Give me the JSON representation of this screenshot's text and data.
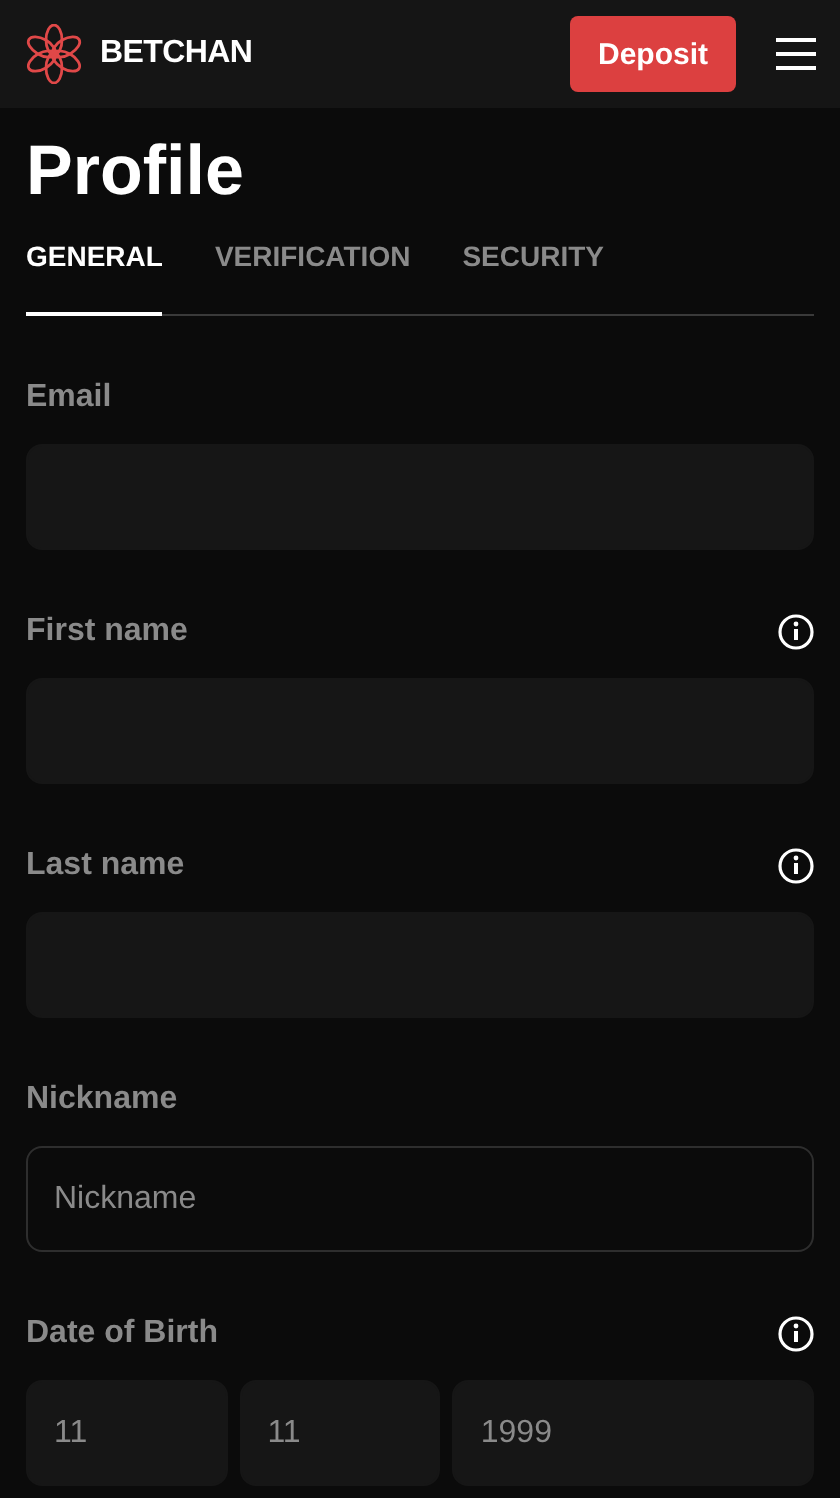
{
  "header": {
    "brand": "BETCHAN",
    "deposit_button": "Deposit"
  },
  "title": "Profile",
  "tabs": [
    {
      "label": "GENERAL",
      "selected": true
    },
    {
      "label": "VERIFICATION",
      "selected": false
    },
    {
      "label": "SECURITY",
      "selected": false
    }
  ],
  "fields": [
    {
      "label": "Email",
      "info": false,
      "inputs": [
        {
          "disabled": true
        }
      ]
    },
    {
      "label": "First name",
      "info": true,
      "inputs": [
        {
          "disabled": true
        }
      ]
    },
    {
      "label": "Last name",
      "info": true,
      "inputs": [
        {
          "disabled": true
        }
      ]
    },
    {
      "label": "Nickname",
      "info": false,
      "inputs": [
        {
          "disabled": false,
          "placeholder": "Nickname"
        }
      ]
    },
    {
      "label": "Date of Birth",
      "info": true,
      "inputs": [
        {
          "disabled": true,
          "value": "11"
        },
        {
          "disabled": true,
          "value": "11"
        },
        {
          "disabled": true,
          "value": "1999"
        }
      ]
    }
  ]
}
